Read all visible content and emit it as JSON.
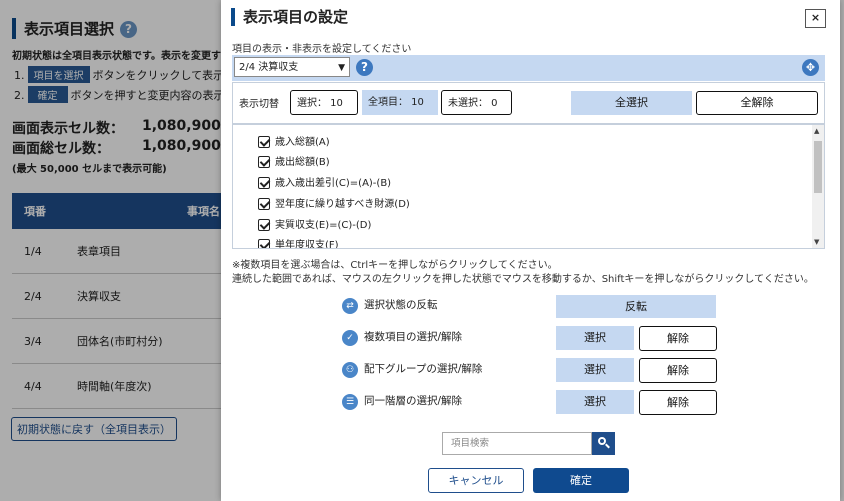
{
  "background": {
    "title": "表示項目選択",
    "help_icon": "?",
    "intro": "初期状態は全項目表示状態です。表示を変更す",
    "step1_num": "1.",
    "step1_chip": "項目を選択",
    "step1_text": "ボタンをクリックして表示項目",
    "step2_num": "2.",
    "step2_chip": "確定",
    "step2_text": "ボタンを押すと変更内容の表示",
    "screen_cells_label": "画面表示セル数：",
    "screen_cells_value": "1,080,900",
    "total_cells_label": "画面総セル数：",
    "total_cells_value": "1,080,900",
    "max_note": "(最大 50,000 セルまで表示可能)",
    "table_headers": [
      "項番",
      "事項名"
    ],
    "table_rows": [
      {
        "num": "1/4",
        "name": "表章項目"
      },
      {
        "num": "2/4",
        "name": "決算収支"
      },
      {
        "num": "3/4",
        "name": "団体名(市町村分)"
      },
      {
        "num": "4/4",
        "name": "時間軸(年度次)"
      }
    ],
    "reset_button": "初期状態に戻す（全項目表示）"
  },
  "modal": {
    "title": "表示項目の設定",
    "close_label": "×",
    "subtitle": "項目の表示・非表示を設定してください",
    "select_value": "2/4 決算収支",
    "filter_label": "表示切替",
    "selected_count": "選択： 10",
    "all_count": "全項目： 10",
    "unselected_count": "未選択： 0",
    "select_all_button": "全選択",
    "deselect_all_button": "全解除",
    "items": [
      "歳入総額(A)",
      "歳出総額(B)",
      "歳入歳出差引(C)=(A)-(B)",
      "翌年度に繰り越すべき財源(D)",
      "実質収支(E)=(C)-(D)",
      "単年度収支(F)"
    ],
    "note1": "※複数項目を選ぶ場合は、Ctrlキーを押しながらクリックしてください。",
    "note2": "連続した範囲であれば、マウスの左クリックを押した状態でマウスを移動するか、Shiftキーを押しながらクリックしてください。",
    "operations": [
      {
        "label": "選択状態の反転",
        "icon": "swap-icon",
        "btn1": "反転",
        "btn2": ""
      },
      {
        "label": "複数項目の選択/解除",
        "icon": "check-circle-icon",
        "btn1": "選択",
        "btn2": "解除"
      },
      {
        "label": "配下グループの選択/解除",
        "icon": "hierarchy-icon",
        "btn1": "選択",
        "btn2": "解除"
      },
      {
        "label": "同一階層の選択/解除",
        "icon": "list-icon",
        "btn1": "選択",
        "btn2": "解除"
      }
    ],
    "search_placeholder": "項目検索",
    "cancel_button": "キャンセル",
    "confirm_button": "確定"
  }
}
